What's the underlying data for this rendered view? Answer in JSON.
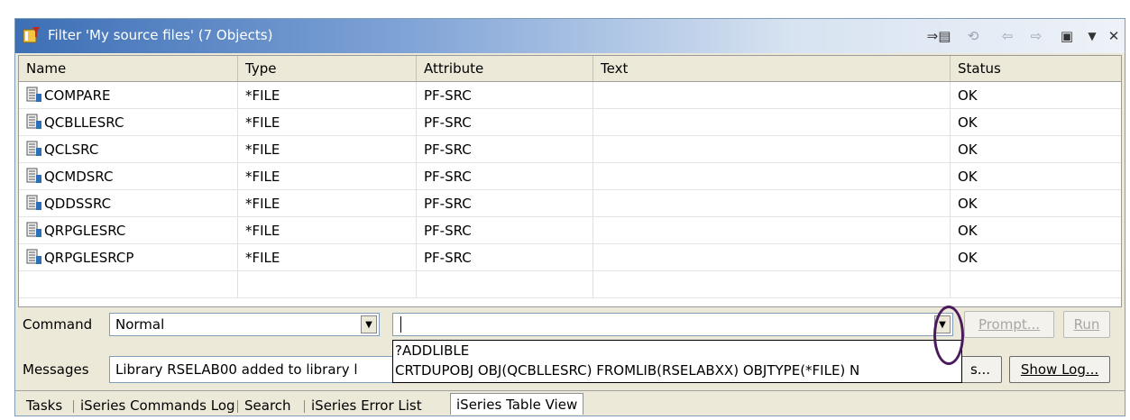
{
  "window": {
    "title": "Filter 'My source files' (7 Objects)",
    "toolbar_icons": [
      "link-with-editor-icon",
      "synchronize-icon",
      "back-icon",
      "forward-icon",
      "up-folder-icon",
      "view-menu-icon",
      "close-icon"
    ]
  },
  "table": {
    "columns": [
      "Name",
      "Type",
      "Attribute",
      "Text",
      "Status"
    ],
    "rows": [
      {
        "name": "COMPARE",
        "type": "*FILE",
        "attribute": "PF-SRC",
        "text": "",
        "status": "OK"
      },
      {
        "name": "QCBLLESRC",
        "type": "*FILE",
        "attribute": "PF-SRC",
        "text": "",
        "status": "OK"
      },
      {
        "name": "QCLSRC",
        "type": "*FILE",
        "attribute": "PF-SRC",
        "text": "",
        "status": "OK"
      },
      {
        "name": "QCMDSRC",
        "type": "*FILE",
        "attribute": "PF-SRC",
        "text": "",
        "status": "OK"
      },
      {
        "name": "QDDSSRC",
        "type": "*FILE",
        "attribute": "PF-SRC",
        "text": "",
        "status": "OK"
      },
      {
        "name": "QRPGLESRC",
        "type": "*FILE",
        "attribute": "PF-SRC",
        "text": "",
        "status": "OK"
      },
      {
        "name": "QRPGLESRCP",
        "type": "*FILE",
        "attribute": "PF-SRC",
        "text": "",
        "status": "OK"
      }
    ]
  },
  "command": {
    "label": "Command",
    "mode_value": "Normal",
    "input_value": "",
    "prompt_label": "Prompt...",
    "run_label": "Run",
    "history": [
      "?ADDLIBLE",
      "CRTDUPOBJ OBJ(QCBLLESRC) FROMLIB(RSELABXX) OBJTYPE(*FILE) N"
    ]
  },
  "messages": {
    "label": "Messages",
    "value": "Library RSELAB00 added to library l",
    "details_label": "s...",
    "show_log_label": "Show Log..."
  },
  "tabs": [
    "Tasks",
    "iSeries Commands Log",
    "Search",
    "iSeries Error List",
    "iSeries Table View"
  ],
  "active_tab": "iSeries Table View"
}
